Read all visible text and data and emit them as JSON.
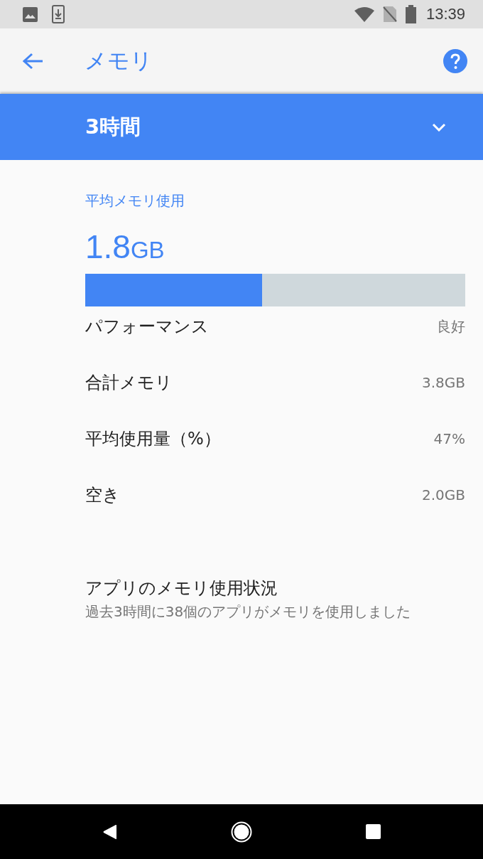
{
  "status_bar": {
    "time": "13:39"
  },
  "toolbar": {
    "title": "メモリ"
  },
  "period_selector": {
    "value": "3時間"
  },
  "summary": {
    "label": "平均メモリ使用",
    "value": "1.8",
    "unit": "GB",
    "level": 0.465
  },
  "stats": [
    {
      "label": "パフォーマンス",
      "value": "良好"
    },
    {
      "label": "合計メモリ",
      "value": "3.8GB"
    },
    {
      "label": "平均使用量（%）",
      "value": "47%"
    },
    {
      "label": "空き",
      "value": "2.0GB"
    }
  ],
  "app_usage": {
    "title": "アプリのメモリ使用状況",
    "subtitle": "過去3時間に38個のアプリがメモリを使用しました"
  }
}
